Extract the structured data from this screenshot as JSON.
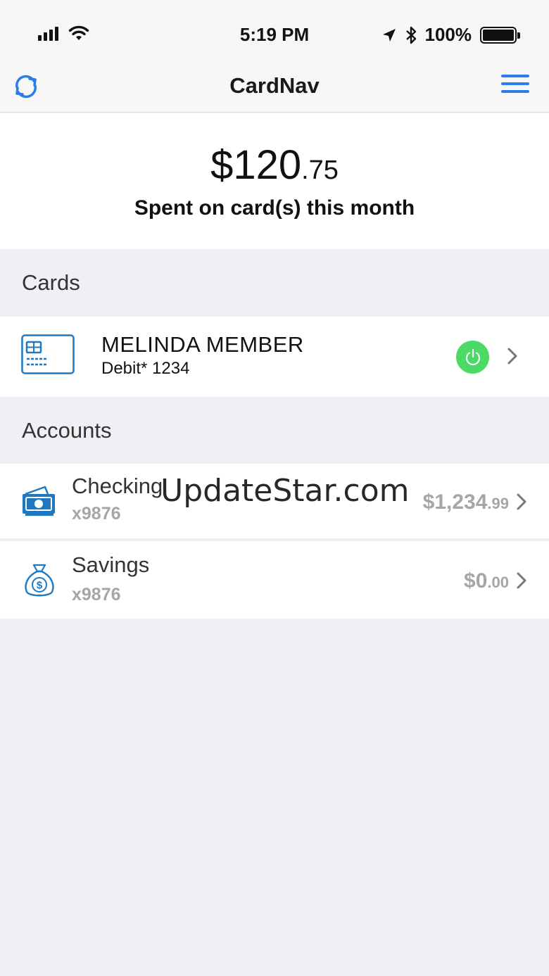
{
  "status_bar": {
    "time": "5:19 PM",
    "battery_percent": "100%",
    "icons": [
      "signal-icon",
      "wifi-icon",
      "location-icon",
      "bluetooth-icon",
      "battery-icon"
    ]
  },
  "nav": {
    "title": "CardNav",
    "left_icon": "refresh-icon",
    "right_icon": "menu-icon"
  },
  "summary": {
    "amount_dollars": "$120",
    "amount_cents": ".75",
    "label": "Spent on card(s) this month"
  },
  "cards": {
    "header": "Cards",
    "items": [
      {
        "name": "MELINDA MEMBER",
        "number": "Debit* 1234",
        "icon": "credit-card-icon",
        "status": "on",
        "status_color": "#4cd964"
      }
    ]
  },
  "accounts": {
    "header": "Accounts",
    "items": [
      {
        "name": "Checking",
        "number": "x9876",
        "balance_dollars": "$1,234",
        "balance_cents": ".99",
        "icon": "cash-icon"
      },
      {
        "name": "Savings",
        "number": "x9876",
        "balance_dollars": "$0",
        "balance_cents": ".00",
        "icon": "money-bag-icon"
      }
    ]
  },
  "watermark": "UpdateStar.com",
  "colors": {
    "accent": "#2b7de9",
    "power_on": "#4cd964",
    "muted": "#a6a6a6",
    "background": "#f0f0f4"
  }
}
